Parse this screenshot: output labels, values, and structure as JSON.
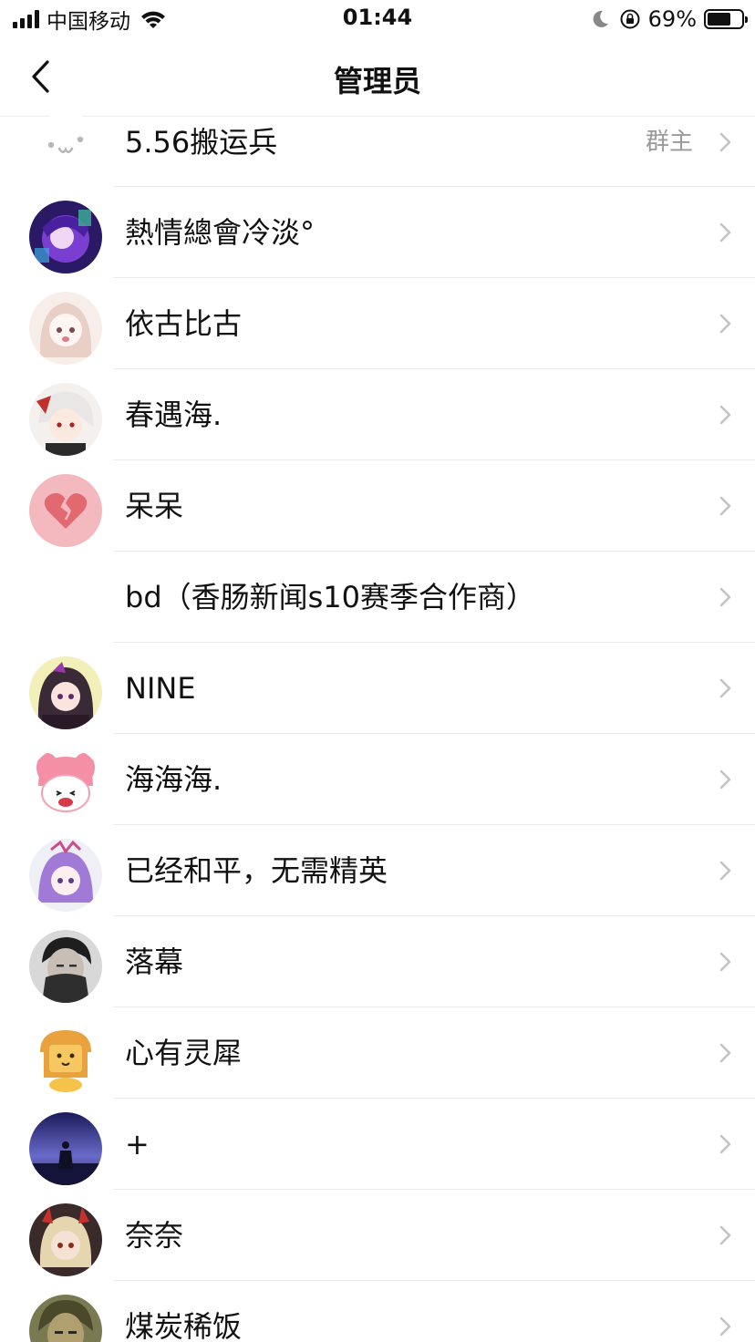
{
  "status_bar": {
    "carrier": "中国移动",
    "time": "01:44",
    "battery_percent_text": "69%",
    "battery_level": 0.69
  },
  "nav": {
    "title": "管理员",
    "back_icon": "chevron-left-icon"
  },
  "members": [
    {
      "name": "5.56搬运兵",
      "role": "群主",
      "avatar": "kaomoji-face"
    },
    {
      "name": "熱情總會冷淡°",
      "role": "",
      "avatar": "purple-anime"
    },
    {
      "name": "依古比古",
      "role": "",
      "avatar": "pink-hair-anime"
    },
    {
      "name": "春遇海.",
      "role": "",
      "avatar": "white-hair-anime"
    },
    {
      "name": "呆呆",
      "role": "",
      "avatar": "broken-heart"
    },
    {
      "name": "bd（香肠新闻s10赛季合作商）",
      "role": "",
      "avatar": "none"
    },
    {
      "name": "NINE",
      "role": "",
      "avatar": "dark-hair-anime"
    },
    {
      "name": "海海海.",
      "role": "",
      "avatar": "my-melody"
    },
    {
      "name": "已经和平，无需精英",
      "role": "",
      "avatar": "violet-hair-anime"
    },
    {
      "name": "落幕",
      "role": "",
      "avatar": "masked-person"
    },
    {
      "name": "心有灵犀",
      "role": "",
      "avatar": "bread-cat"
    },
    {
      "name": "+",
      "role": "",
      "avatar": "night-sky"
    },
    {
      "name": "奈奈",
      "role": "",
      "avatar": "horned-anime"
    },
    {
      "name": "煤炭稀饭",
      "role": "",
      "avatar": "soldier-portrait"
    }
  ],
  "colors": {
    "text": "#111111",
    "secondary": "#9a9a9a",
    "divider": "#ececec",
    "chevron": "#c4c4c4"
  }
}
